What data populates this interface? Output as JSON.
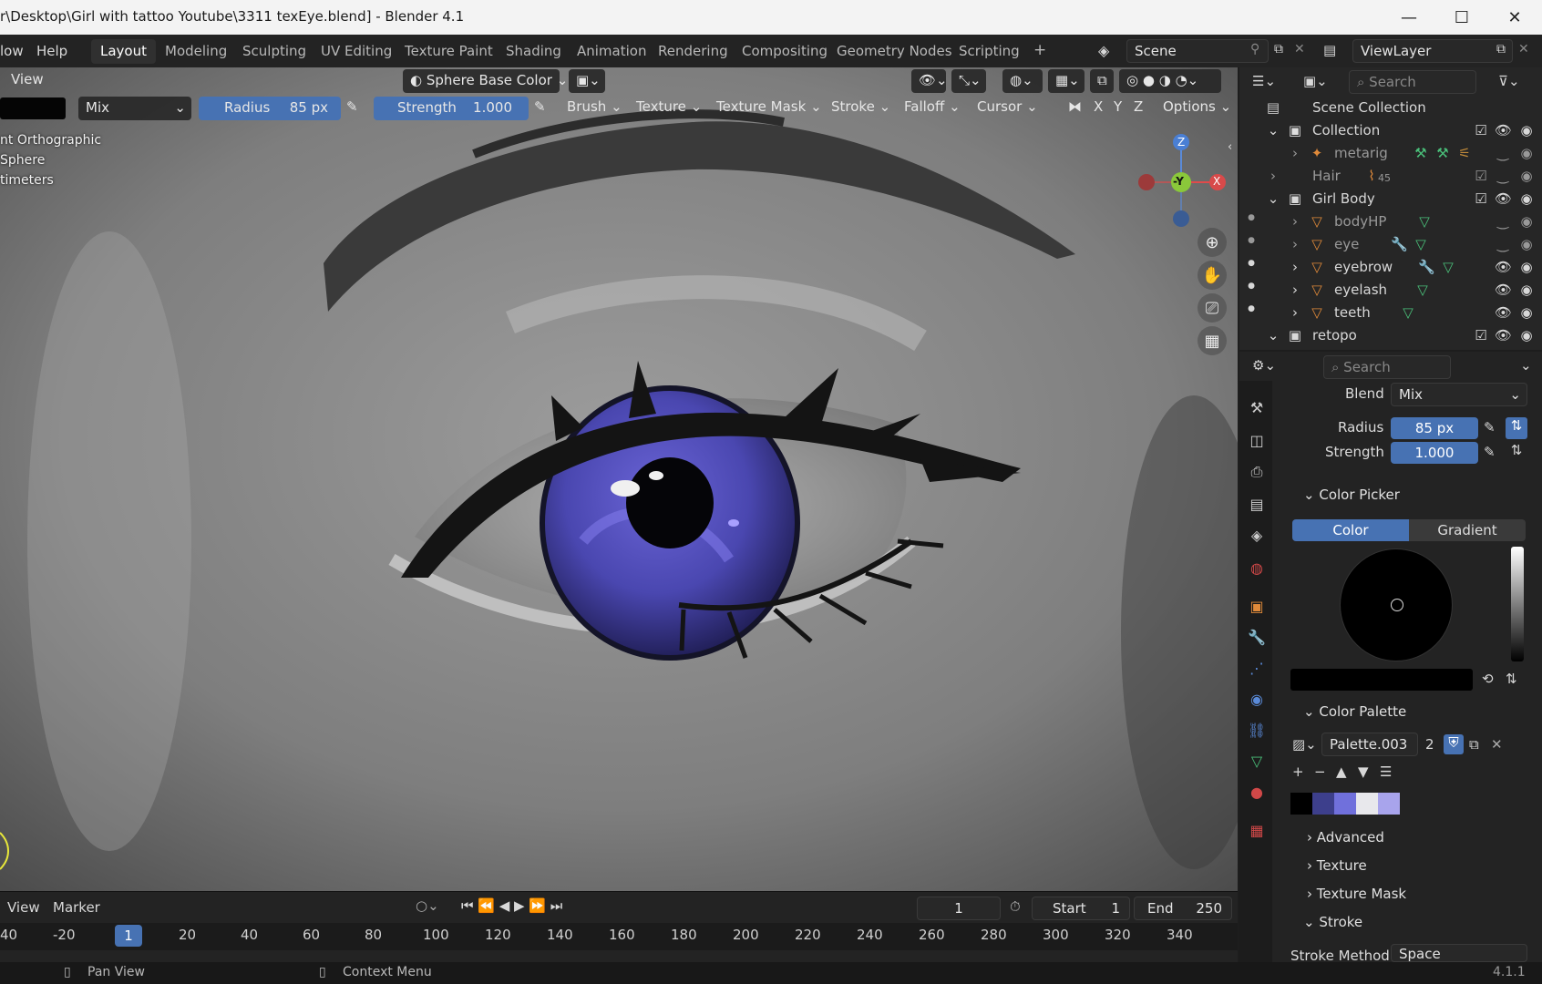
{
  "window": {
    "title": "r\\Desktop\\Girl with tattoo Youtube\\3311 texEye.blend] - Blender 4.1",
    "minimize": "—",
    "maximize": "☐",
    "close": "✕"
  },
  "menu": {
    "window_partial": "low",
    "help": "Help"
  },
  "workspaces": [
    "Layout",
    "Modeling",
    "Sculpting",
    "UV Editing",
    "Texture Paint",
    "Shading",
    "Animation",
    "Rendering",
    "Compositing",
    "Geometry Nodes",
    "Scripting"
  ],
  "active_workspace": "Layout",
  "add_workspace": "+",
  "scene": {
    "name": "Scene"
  },
  "view_layer": {
    "name": "ViewLayer"
  },
  "viewport_header": {
    "view_menu": "View",
    "shading_mode": "Sphere Base Color"
  },
  "tool_header": {
    "blend": "Mix",
    "radius_label": "Radius",
    "radius_value": "85 px",
    "strength_label": "Strength",
    "strength_value": "1.000",
    "brush": "Brush",
    "texture": "Texture",
    "texture_mask": "Texture Mask",
    "stroke": "Stroke",
    "falloff": "Falloff",
    "cursor": "Cursor",
    "axis_x": "X",
    "axis_y": "Y",
    "axis_z": "Z",
    "options": "Options"
  },
  "viewport_info": {
    "line1": "nt Orthographic",
    "line2": "Sphere",
    "line3": "timeters"
  },
  "gizmo": {
    "z": "Z",
    "y": "-Y",
    "x": "X"
  },
  "outliner": {
    "search_placeholder": "Search",
    "rows": [
      {
        "label": "Scene Collection",
        "type": "scene"
      },
      {
        "label": "Collection",
        "type": "collection"
      },
      {
        "label": "metarig",
        "type": "armature"
      },
      {
        "label": "Hair",
        "type": "collection",
        "badge": "45"
      },
      {
        "label": "Girl Body",
        "type": "collection"
      },
      {
        "label": "bodyHP",
        "type": "mesh"
      },
      {
        "label": "eye",
        "type": "mesh"
      },
      {
        "label": "eyebrow",
        "type": "mesh"
      },
      {
        "label": "eyelash",
        "type": "mesh"
      },
      {
        "label": "teeth",
        "type": "mesh"
      },
      {
        "label": "retopo",
        "type": "collection"
      }
    ]
  },
  "properties": {
    "search_placeholder": "Search",
    "blend_label": "Blend",
    "blend_value": "Mix",
    "radius_label": "Radius",
    "radius_value": "85 px",
    "strength_label": "Strength",
    "strength_value": "1.000",
    "color_picker": "Color Picker",
    "color_tab": "Color",
    "gradient_tab": "Gradient",
    "color_palette": "Color Palette",
    "palette_name": "Palette.003",
    "palette_users": "2",
    "palette_colors": [
      "#000000",
      "#3d3f8c",
      "#7070dc",
      "#e8e8ec",
      "#a8a4ec"
    ],
    "advanced": "Advanced",
    "texture": "Texture",
    "texture_mask": "Texture Mask",
    "stroke": "Stroke",
    "stroke_method_label": "Stroke Method",
    "stroke_method_value": "Space"
  },
  "timeline": {
    "view": "View",
    "marker": "Marker",
    "current_frame": "1",
    "start_label": "Start",
    "start_value": "1",
    "end_label": "End",
    "end_value": "250",
    "ticks": [
      "40",
      "-20",
      "1",
      "20",
      "40",
      "60",
      "80",
      "100",
      "120",
      "140",
      "160",
      "180",
      "200",
      "220",
      "240",
      "260",
      "280",
      "300",
      "320",
      "340"
    ]
  },
  "statusbar": {
    "pan_view": "Pan View",
    "context_menu": "Context Menu",
    "version": "4.1.1"
  },
  "colors": {
    "accent": "#4772b3",
    "iris": "#4a47b0"
  }
}
